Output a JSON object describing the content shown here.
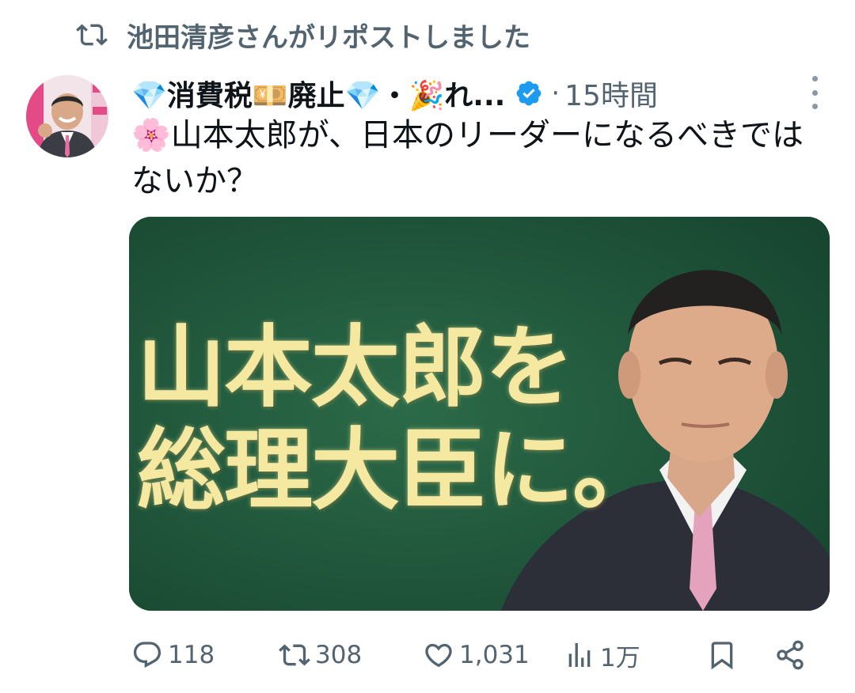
{
  "repost": {
    "icon": "repost-icon",
    "text": "池田清彦さんがリポストしました"
  },
  "author": {
    "display_name": "💎消費税💴廃止💎・🎉れ...",
    "verified": true,
    "verified_color": "#1d9bf0",
    "separator": "·",
    "time": "15時間"
  },
  "tweet": {
    "text": "🌸山本太郎が、日本のリーダーになるべきではないか？"
  },
  "media": {
    "line1": "山本太郎を",
    "line2": "総理大臣に。"
  },
  "actions": {
    "replies": "118",
    "reposts": "308",
    "likes": "1,031",
    "views": "1万"
  },
  "colors": {
    "muted": "#536471",
    "text": "#0f1419",
    "chalkboard": "#1f5a3b",
    "headline": "#f5e9a2"
  }
}
